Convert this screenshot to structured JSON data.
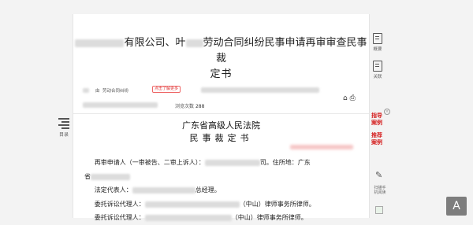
{
  "toc": {
    "label": "目录",
    "icon": "list-icon"
  },
  "title": {
    "line1_visible": "有限公司、叶",
    "line1_rest": "劳动合同纠纷民事申请再审审查民事裁",
    "line2": "定书"
  },
  "meta": {
    "cause_label": "由",
    "cause": "劳动合同纠纷",
    "tag": "点击了解更多",
    "views_label": "浏览次数",
    "views": "288",
    "icons": [
      "bookmark-icon",
      "print-icon"
    ]
  },
  "document": {
    "court": "广东省高级人民法院",
    "doc_type": "民事裁定书"
  },
  "body": {
    "p1_start": "再审申请人（一审被告、二审上诉人）：",
    "p1_end": "司。住所地：广东",
    "p2_start": "省",
    "p3_start": "法定代表人：",
    "p3_end": "总经理。",
    "p4_start": "委托诉讼代理人：",
    "p4_end": "（中山）律师事务所律师。",
    "p5_start": "委托诉讼代理人：",
    "p5_end": "（中山）律师事务所律师。"
  },
  "sidebar": {
    "summary": "概要",
    "related": "关联",
    "promo1": [
      "指导",
      "案例"
    ],
    "promo2": [
      "推荐",
      "案例"
    ],
    "scan_text": [
      "扫描手",
      "机阅读"
    ]
  },
  "corner": {
    "glyph": "A"
  }
}
